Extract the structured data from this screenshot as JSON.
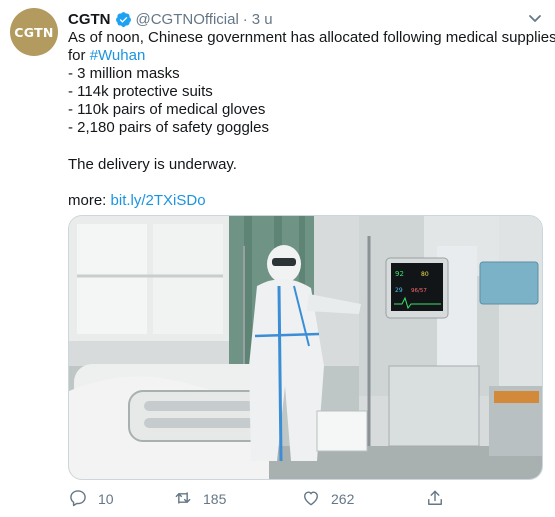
{
  "tweet": {
    "avatar_text": "CGTN",
    "name": "CGTN",
    "handle": "@CGTNOfficial",
    "separator": "·",
    "time": "3 u",
    "text_line1": "As of noon, Chinese government has allocated following medical supplies",
    "text_line2_prefix": "for ",
    "hashtag": "#Wuhan",
    "items": [
      "- 3 million masks",
      "- 114k protective suits",
      "- 110k pairs of medical gloves",
      "- 2,180 pairs of safety goggles"
    ],
    "delivery": "The delivery is underway.",
    "more_prefix": "more: ",
    "more_link": "bit.ly/2TXiSDo",
    "reply_count": "10",
    "retweet_count": "185",
    "like_count": "262"
  },
  "photo": {
    "monitor_lines": [
      "92",
      "80",
      "29",
      "96/57"
    ]
  },
  "colors": {
    "link": "#1b95e0",
    "secondary": "#657786",
    "avatar_bg": "#b39a5e"
  },
  "icons": [
    "verified-badge-icon",
    "chevron-down-icon",
    "reply-icon",
    "retweet-icon",
    "like-icon",
    "share-icon"
  ]
}
